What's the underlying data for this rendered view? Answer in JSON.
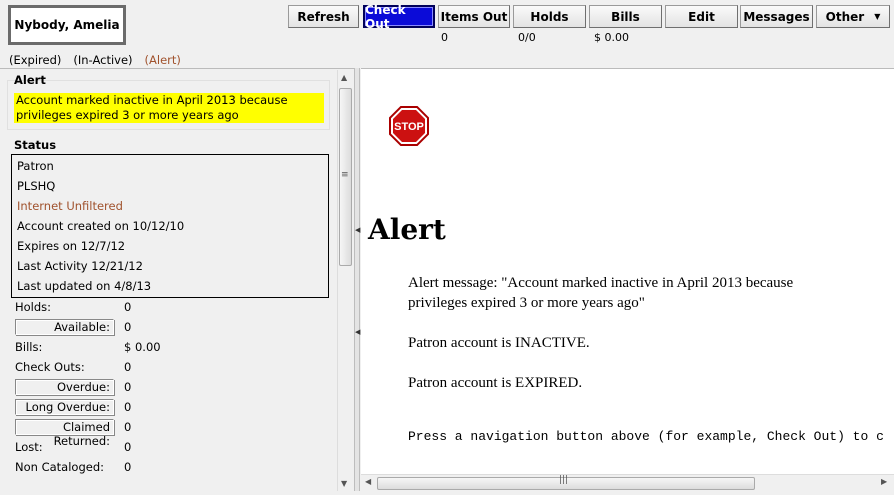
{
  "patron": {
    "name": "Nybody, Amelia",
    "flags": [
      "(Expired)",
      "(In-Active)",
      "(Alert)"
    ]
  },
  "toolbar": {
    "refresh": "Refresh",
    "check_out": "Check Out",
    "items_out": "Items Out",
    "holds": "Holds",
    "bills": "Bills",
    "edit": "Edit",
    "messages": "Messages",
    "other": "Other",
    "items_out_count": "0",
    "holds_count": "0/0",
    "bills_amount": "$ 0.00"
  },
  "alert_group": {
    "title": "Alert",
    "text": "Account marked inactive in April 2013 because privileges expired 3 or more years ago"
  },
  "status_group": {
    "title": "Status",
    "lines": [
      "Patron",
      "PLSHQ",
      "Internet Unfiltered",
      "Account created on 10/12/10",
      "Expires on 12/7/12",
      "Last Activity 12/21/12",
      "Last updated on 4/8/13"
    ]
  },
  "summary": {
    "holds_label": "Holds:",
    "holds_value": "0",
    "available_label": "Available:",
    "available_value": "0",
    "bills_label": "Bills:",
    "bills_value": "$ 0.00",
    "checkouts_label": "Check Outs:",
    "checkouts_value": "0",
    "overdue_label": "Overdue:",
    "overdue_value": "0",
    "long_overdue_label": "Long Overdue:",
    "long_overdue_value": "0",
    "claimed_label": "Claimed Returned:",
    "claimed_value": "0",
    "lost_label": "Lost:",
    "lost_value": "0",
    "noncat_label": "Non Cataloged:",
    "noncat_value": "0"
  },
  "main": {
    "stop_sign_text": "STOP",
    "heading": "Alert",
    "message_line1": "Alert message: \"Account marked inactive in April 2013 because",
    "message_line2": "privileges expired 3 or more years ago\"",
    "inactive": "Patron account is INACTIVE.",
    "expired": "Patron account is EXPIRED.",
    "nav_hint": "Press a navigation button above (for example, Check Out) to c"
  },
  "colors": {
    "alert_highlight": "#ffff00",
    "flag_alert": "#a0522d",
    "active_button": "#0b0bd8",
    "stop_red": "#cc1111"
  },
  "icons": {
    "stop": "stop-sign-icon",
    "dropdown": "chevron-down-icon"
  }
}
